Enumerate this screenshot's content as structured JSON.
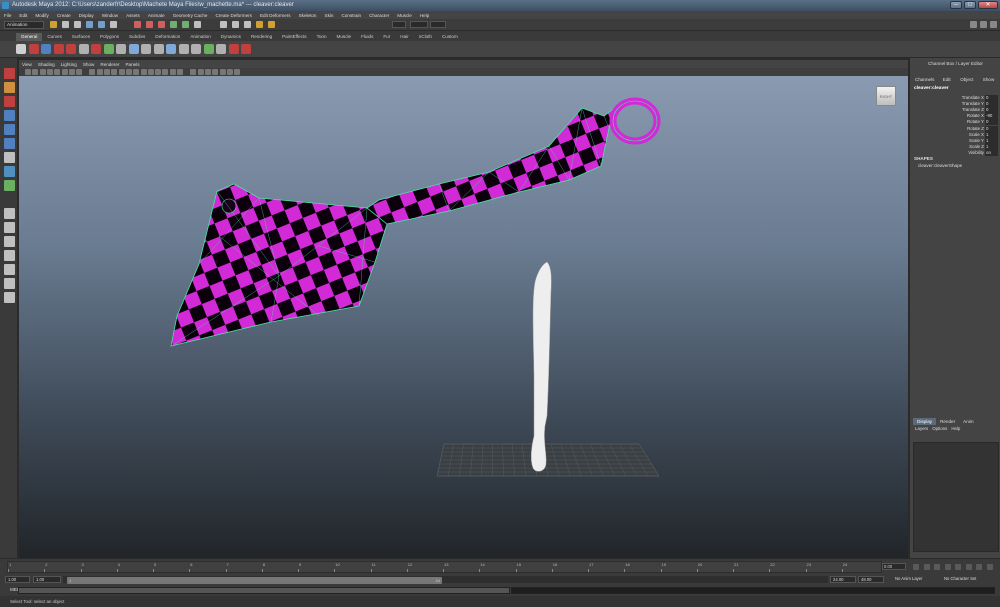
{
  "window": {
    "title": "Autodesk Maya 2012: C:\\Users\\zanderfr\\Desktop\\Machete Maya Files\\w_machette.ma*   ---   cleaver:cleaver",
    "minimize_glyph": "–",
    "maximize_glyph": "□",
    "close_glyph": "✕"
  },
  "menubar": {
    "items": [
      "File",
      "Edit",
      "Modify",
      "Create",
      "Display",
      "Window",
      "Assets",
      "Animate",
      "Geometry Cache",
      "Create Deformers",
      "Edit Deformers",
      "Skeleton",
      "Skin",
      "Constrain",
      "Character",
      "Muscle",
      "Help"
    ]
  },
  "statusline": {
    "mode": "Animation",
    "icon_colors": [
      "#d0a030",
      "#c0c0c0",
      "#c0c0c0",
      "#6fa0d0",
      "#6fa0d0",
      "#c0c0c0",
      "#d06060",
      "#d06060",
      "#d06060",
      "#6fb070",
      "#6fb070",
      "#c0c0c0",
      "#c0c0c0",
      "#c0c0c0",
      "#c0c0c0",
      "#d0a030",
      "#d0a030"
    ]
  },
  "shelf": {
    "tabs": [
      "General",
      "Curves",
      "Surfaces",
      "Polygons",
      "Subdivs",
      "Deformation",
      "Animation",
      "Dynamics",
      "Rendering",
      "PaintEffects",
      "Toon",
      "Muscle",
      "Fluids",
      "Fur",
      "Hair",
      "nCloth",
      "Custom"
    ],
    "active_tab": "General",
    "icon_colors": [
      "#d0d0d0",
      "#c04040",
      "#5080c0",
      "#c04040",
      "#c04040",
      "#b0b0b0",
      "#c04040",
      "#6ab060",
      "#b0b0b0",
      "#7fa9d8",
      "#b0b0b0",
      "#b0b0b0",
      "#7fa9d8",
      "#b0b0b0",
      "#b0b0b0",
      "#6ab060",
      "#b0b0b0",
      "#c04040",
      "#c04040"
    ]
  },
  "toolbox": {
    "tool_colors": [
      "#c04040",
      "#d09040",
      "#c04040",
      "#5080c0",
      "#5080c0",
      "#5080c0",
      "#c0c0c0",
      "#5090c0",
      "#6ab060",
      "#c0c0c0",
      "#c0c0c0",
      "#c0c0c0",
      "#c0c0c0",
      "#c0c0c0",
      "#c0c0c0",
      "#c0c0c0"
    ]
  },
  "viewport": {
    "menu": [
      "View",
      "Shading",
      "Lighting",
      "Show",
      "Renderer",
      "Panels"
    ],
    "viewcube_label": "RIGHT",
    "cleaver_color": "#d22ad6",
    "wire_color": "#46e6a0",
    "machete_color": "#eeeeee",
    "grid_color": "#555a5e"
  },
  "channelbox": {
    "header": "Channel Box / Layer Editor",
    "menu": [
      "Channels",
      "Edit",
      "Object",
      "Show"
    ],
    "object_name": "cleaver:cleaver",
    "attributes": [
      {
        "name": "Translate X",
        "value": "0"
      },
      {
        "name": "Translate Y",
        "value": "0"
      },
      {
        "name": "Translate Z",
        "value": "0"
      },
      {
        "name": "Rotate X",
        "value": "-90"
      },
      {
        "name": "Rotate Y",
        "value": "0"
      },
      {
        "name": "Rotate Z",
        "value": "0"
      },
      {
        "name": "Scale X",
        "value": "1"
      },
      {
        "name": "Scale Y",
        "value": "1"
      },
      {
        "name": "Scale Z",
        "value": "1"
      },
      {
        "name": "Visibility",
        "value": "on"
      }
    ],
    "shapes_label": "SHAPES",
    "shape_name": "cleaver:cleaverShape",
    "layer_tabs": [
      "Display",
      "Render",
      "Anim"
    ],
    "layer_menu": [
      "Layers",
      "Options",
      "Help"
    ]
  },
  "timeslider": {
    "ticks": [
      "1",
      "2",
      "3",
      "4",
      "5",
      "6",
      "7",
      "8",
      "9",
      "10",
      "11",
      "12",
      "13",
      "14",
      "15",
      "16",
      "17",
      "18",
      "19",
      "20",
      "21",
      "22",
      "23",
      "24"
    ],
    "current_frame": "0.00"
  },
  "rangeslider": {
    "start": "1.00",
    "start2": "1.00",
    "range_start": "1",
    "range_end": "24",
    "end": "24.00",
    "end2": "48.00",
    "anim_layer": "No Anim Layer",
    "char_set": "No Character Set"
  },
  "cmdline": {
    "label": "MEL"
  },
  "helpline": {
    "text": "Select Tool: select an object"
  }
}
